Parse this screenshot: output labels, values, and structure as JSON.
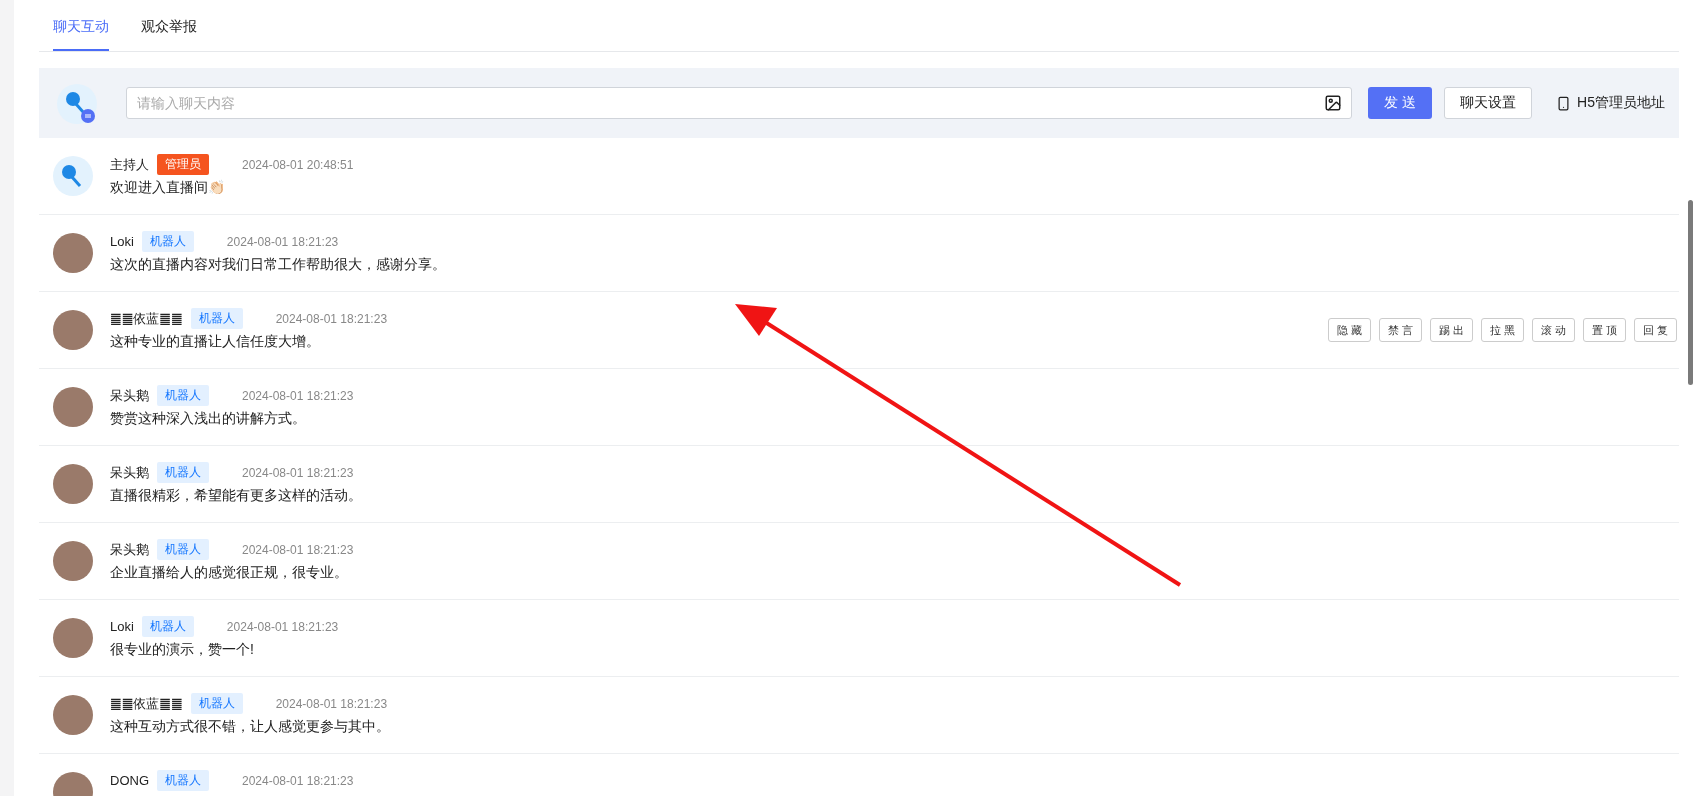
{
  "tabs": [
    {
      "label": "聊天互动",
      "selected": true
    },
    {
      "label": "观众举报",
      "selected": false
    }
  ],
  "composer": {
    "placeholder": "请输入聊天内容",
    "send": "发 送",
    "settings": "聊天设置",
    "h5_link": "H5管理员地址"
  },
  "messages": [
    {
      "kind": "host",
      "name": "主持人",
      "tag": {
        "kind": "admin",
        "label": "管理员"
      },
      "time": "2024-08-01 20:48:51",
      "text": "欢迎进入直播间👏🏻"
    },
    {
      "kind": "photo",
      "name": "Loki",
      "tag": {
        "kind": "bot",
        "label": "机器人"
      },
      "time": "2024-08-01 18:21:23",
      "text": "这次的直播内容对我们日常工作帮助很大，感谢分享。"
    },
    {
      "kind": "photo",
      "name": "䷀䷀依蓝䷀䷀",
      "tag": {
        "kind": "bot",
        "label": "机器人"
      },
      "time": "2024-08-01 18:21:23",
      "text": "这种专业的直播让人信任度大增。",
      "actions": [
        "隐 藏",
        "禁 言",
        "踢 出",
        "拉 黑",
        "滚 动",
        "置 顶",
        "回 复"
      ]
    },
    {
      "kind": "photo",
      "name": "呆头鹅",
      "tag": {
        "kind": "bot",
        "label": "机器人"
      },
      "time": "2024-08-01 18:21:23",
      "text": "赞赏这种深入浅出的讲解方式。"
    },
    {
      "kind": "photo",
      "name": "呆头鹅",
      "tag": {
        "kind": "bot",
        "label": "机器人"
      },
      "time": "2024-08-01 18:21:23",
      "text": "直播很精彩，希望能有更多这样的活动。"
    },
    {
      "kind": "photo",
      "name": "呆头鹅",
      "tag": {
        "kind": "bot",
        "label": "机器人"
      },
      "time": "2024-08-01 18:21:23",
      "text": "企业直播给人的感觉很正规，很专业。"
    },
    {
      "kind": "photo",
      "name": "Loki",
      "tag": {
        "kind": "bot",
        "label": "机器人"
      },
      "time": "2024-08-01 18:21:23",
      "text": "很专业的演示，赞一个!"
    },
    {
      "kind": "photo",
      "name": "䷀䷀依蓝䷀䷀",
      "tag": {
        "kind": "bot",
        "label": "机器人"
      },
      "time": "2024-08-01 18:21:23",
      "text": "这种互动方式很不错，让人感觉更参与其中。"
    },
    {
      "kind": "photo",
      "name": "DONG",
      "tag": {
        "kind": "bot",
        "label": "机器人"
      },
      "time": "2024-08-01 18:21:23"
    }
  ]
}
